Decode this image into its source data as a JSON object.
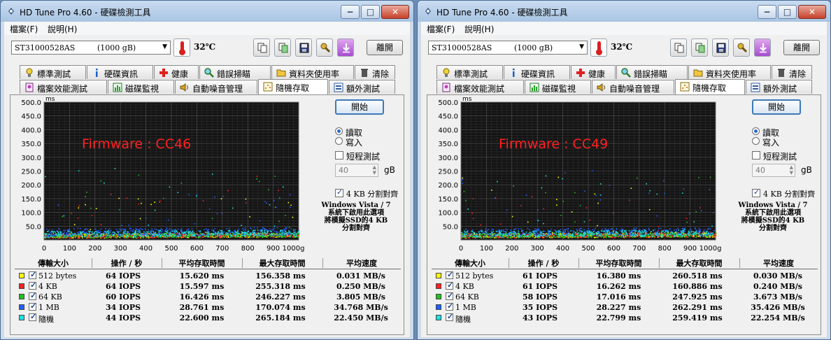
{
  "windows": [
    {
      "title": "HD Tune Pro 4.60 - 硬碟檢測工具",
      "menu": [
        "檔案(F)",
        "說明(H)"
      ],
      "drive": {
        "name": "ST31000528AS",
        "size": "(1000 gB)"
      },
      "temperature": "32℃",
      "exit_label": "離開",
      "tabs_row1": [
        "標準測試",
        "硬碟資訊",
        "健康",
        "錯誤掃瞄",
        "資料夾使用率",
        "清除"
      ],
      "tabs_row2": [
        "檔案效能測試",
        "磁碟監視",
        "自動噪音管理",
        "隨機存取",
        "額外測試"
      ],
      "chart_data": {
        "type": "scatter",
        "y_unit": "ms",
        "x_unit": "gB",
        "yticks": [
          "500.0",
          "450.0",
          "400.0",
          "350.0",
          "300.0",
          "250.0",
          "200.0",
          "150.0",
          "100.0",
          "50.0"
        ],
        "xticks": [
          "0",
          "100",
          "200",
          "300",
          "400",
          "500",
          "600",
          "700",
          "800",
          "900",
          "1000gB"
        ],
        "ylim": [
          0,
          500
        ],
        "xlim": [
          0,
          1000
        ],
        "annotation": "Firmware : CC46",
        "series": [
          {
            "name": "512 bytes",
            "color": "#ffff00",
            "values_ms": {
              "avg": 15.62,
              "max": 156.358
            }
          },
          {
            "name": "4 KB",
            "color": "#ff2020",
            "values_ms": {
              "avg": 15.597,
              "max": 255.318
            }
          },
          {
            "name": "64 KB",
            "color": "#20c020",
            "values_ms": {
              "avg": 16.426,
              "max": 246.227
            }
          },
          {
            "name": "1 MB",
            "color": "#2060ff",
            "values_ms": {
              "avg": 28.761,
              "max": 170.074
            }
          },
          {
            "name": "隨機",
            "color": "#20e0e0",
            "values_ms": {
              "avg": 22.6,
              "max": 265.184
            }
          }
        ]
      },
      "start_label": "開始",
      "radio_read": "讀取",
      "radio_write": "寫入",
      "short_test": "短程測試",
      "short_value": "40",
      "short_unit": "gB",
      "align_label": "4 KB 分割對齊",
      "note": [
        "Windows Vista / 7",
        "系統下啟用此選項",
        "將模擬SSD的4 KB",
        "分割對齊"
      ],
      "headers": [
        "傳輸大小",
        "操作 / 秒",
        "平均存取時間",
        "最大存取時間",
        "平均速度"
      ],
      "rows": [
        {
          "color": "#ffff00",
          "name": "512 bytes",
          "iops": "64 IOPS",
          "avg": "15.620 ms",
          "max": "156.358 ms",
          "speed": "0.031 MB/s"
        },
        {
          "color": "#ff2020",
          "name": "4 KB",
          "iops": "64 IOPS",
          "avg": "15.597 ms",
          "max": "255.318 ms",
          "speed": "0.250 MB/s"
        },
        {
          "color": "#20c020",
          "name": "64 KB",
          "iops": "60 IOPS",
          "avg": "16.426 ms",
          "max": "246.227 ms",
          "speed": "3.805 MB/s"
        },
        {
          "color": "#2060ff",
          "name": "1 MB",
          "iops": "34 IOPS",
          "avg": "28.761 ms",
          "max": "170.074 ms",
          "speed": "34.768 MB/s"
        },
        {
          "color": "#20e0e0",
          "name": "隨機",
          "iops": "44 IOPS",
          "avg": "22.600 ms",
          "max": "265.184 ms",
          "speed": "22.450 MB/s"
        }
      ]
    },
    {
      "title": "HD Tune Pro 4.60 - 硬碟檢測工具",
      "menu": [
        "檔案(F)",
        "說明(H)"
      ],
      "drive": {
        "name": "ST31000528AS",
        "size": "(1000 gB)"
      },
      "temperature": "32℃",
      "exit_label": "離開",
      "tabs_row1": [
        "標準測試",
        "硬碟資訊",
        "健康",
        "錯誤掃瞄",
        "資料夾使用率",
        "清除"
      ],
      "tabs_row2": [
        "檔案效能測試",
        "磁碟監視",
        "自動噪音管理",
        "隨機存取",
        "額外測試"
      ],
      "chart_data": {
        "type": "scatter",
        "y_unit": "ms",
        "x_unit": "gB",
        "yticks": [
          "500.0",
          "450.0",
          "400.0",
          "350.0",
          "300.0",
          "250.0",
          "200.0",
          "150.0",
          "100.0",
          "50.0"
        ],
        "xticks": [
          "0",
          "100",
          "200",
          "300",
          "400",
          "500",
          "600",
          "700",
          "800",
          "900",
          "1000gB"
        ],
        "ylim": [
          0,
          500
        ],
        "xlim": [
          0,
          1000
        ],
        "annotation": "Firmware : CC49",
        "series": [
          {
            "name": "512 bytes",
            "color": "#ffff00",
            "values_ms": {
              "avg": 16.38,
              "max": 260.518
            }
          },
          {
            "name": "4 KB",
            "color": "#ff2020",
            "values_ms": {
              "avg": 16.262,
              "max": 160.886
            }
          },
          {
            "name": "64 KB",
            "color": "#20c020",
            "values_ms": {
              "avg": 17.016,
              "max": 247.925
            }
          },
          {
            "name": "1 MB",
            "color": "#2060ff",
            "values_ms": {
              "avg": 28.227,
              "max": 262.291
            }
          },
          {
            "name": "隨機",
            "color": "#20e0e0",
            "values_ms": {
              "avg": 22.799,
              "max": 259.419
            }
          }
        ]
      },
      "start_label": "開始",
      "radio_read": "讀取",
      "radio_write": "寫入",
      "short_test": "短程測試",
      "short_value": "40",
      "short_unit": "gB",
      "align_label": "4 KB 分割對齊",
      "note": [
        "Windows Vista / 7",
        "系統下啟用此選項",
        "將模擬SSD的4 KB",
        "分割對齊"
      ],
      "headers": [
        "傳輸大小",
        "操作 / 秒",
        "平均存取時間",
        "最大存取時間",
        "平均速度"
      ],
      "rows": [
        {
          "color": "#ffff00",
          "name": "512 bytes",
          "iops": "61 IOPS",
          "avg": "16.380 ms",
          "max": "260.518 ms",
          "speed": "0.030 MB/s"
        },
        {
          "color": "#ff2020",
          "name": "4 KB",
          "iops": "61 IOPS",
          "avg": "16.262 ms",
          "max": "160.886 ms",
          "speed": "0.240 MB/s"
        },
        {
          "color": "#20c020",
          "name": "64 KB",
          "iops": "58 IOPS",
          "avg": "17.016 ms",
          "max": "247.925 ms",
          "speed": "3.673 MB/s"
        },
        {
          "color": "#2060ff",
          "name": "1 MB",
          "iops": "35 IOPS",
          "avg": "28.227 ms",
          "max": "262.291 ms",
          "speed": "35.426 MB/s"
        },
        {
          "color": "#20e0e0",
          "name": "隨機",
          "iops": "43 IOPS",
          "avg": "22.799 ms",
          "max": "259.419 ms",
          "speed": "22.254 MB/s"
        }
      ]
    }
  ]
}
